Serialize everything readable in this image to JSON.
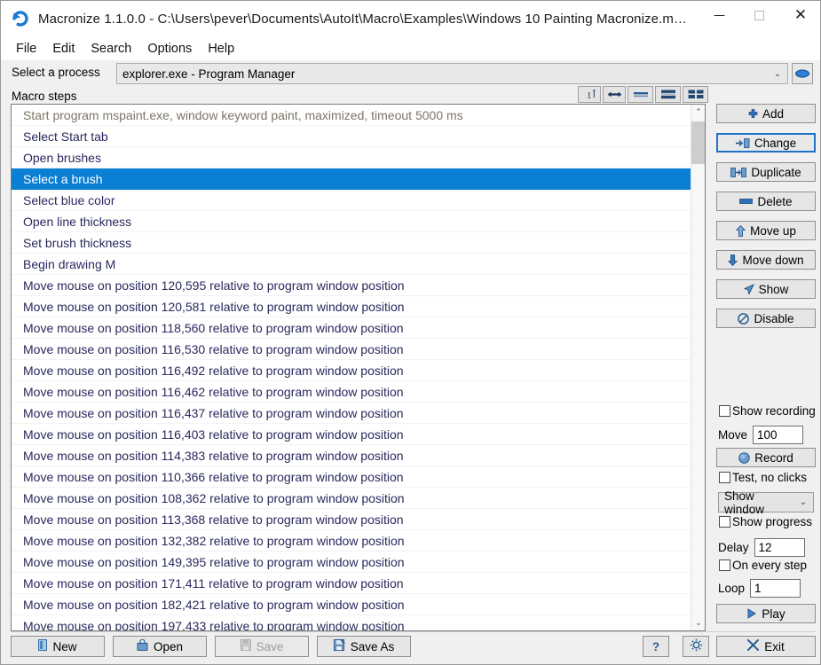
{
  "window": {
    "title": "Macronize 1.1.0.0 - C:\\Users\\pever\\Documents\\AutoIt\\Macro\\Examples\\Windows 10 Painting Macronize.m…",
    "app_icon": "refresh-circle-icon",
    "minimize": "—",
    "maximize": "▢",
    "close": "✕"
  },
  "menu": {
    "items": [
      {
        "label": "File"
      },
      {
        "label": "Edit"
      },
      {
        "label": "Search"
      },
      {
        "label": "Options"
      },
      {
        "label": "Help"
      }
    ]
  },
  "process": {
    "label": "Select a process",
    "value": "explorer.exe - Program Manager",
    "arrow": "⌄",
    "eye_icon": "eye-icon"
  },
  "steps": {
    "label": "Macro steps",
    "tools": [
      {
        "name": "numbering-icon",
        "title": "1"
      },
      {
        "name": "resize-horizontal-icon",
        "title": "↔"
      },
      {
        "name": "view-single-line-icon",
        "title": "="
      },
      {
        "name": "view-two-line-icon",
        "title": "≡"
      },
      {
        "name": "view-grid-icon",
        "title": "▦"
      }
    ],
    "rows": [
      {
        "text": "Start program mspaint.exe, window keyword paint, maximized, timeout 5000 ms",
        "state": "dim"
      },
      {
        "text": "Select Start tab",
        "state": "normal"
      },
      {
        "text": "Open brushes",
        "state": "normal"
      },
      {
        "text": "Select a brush",
        "state": "selected"
      },
      {
        "text": "Select blue color",
        "state": "normal"
      },
      {
        "text": "Open line thickness",
        "state": "normal"
      },
      {
        "text": "Set brush thickness",
        "state": "normal"
      },
      {
        "text": "Begin drawing M",
        "state": "normal"
      },
      {
        "text": "Move mouse on position 120,595 relative to program window position",
        "state": "normal"
      },
      {
        "text": "Move mouse on position 120,581 relative to program window position",
        "state": "normal"
      },
      {
        "text": "Move mouse on position 118,560 relative to program window position",
        "state": "normal"
      },
      {
        "text": "Move mouse on position 116,530 relative to program window position",
        "state": "normal"
      },
      {
        "text": "Move mouse on position 116,492 relative to program window position",
        "state": "normal"
      },
      {
        "text": "Move mouse on position 116,462 relative to program window position",
        "state": "normal"
      },
      {
        "text": "Move mouse on position 116,437 relative to program window position",
        "state": "normal"
      },
      {
        "text": "Move mouse on position 116,403 relative to program window position",
        "state": "normal"
      },
      {
        "text": "Move mouse on position 114,383 relative to program window position",
        "state": "normal"
      },
      {
        "text": "Move mouse on position 110,366 relative to program window position",
        "state": "normal"
      },
      {
        "text": "Move mouse on position 108,362 relative to program window position",
        "state": "normal"
      },
      {
        "text": "Move mouse on position 113,368 relative to program window position",
        "state": "normal"
      },
      {
        "text": "Move mouse on position 132,382 relative to program window position",
        "state": "normal"
      },
      {
        "text": "Move mouse on position 149,395 relative to program window position",
        "state": "normal"
      },
      {
        "text": "Move mouse on position 171,411 relative to program window position",
        "state": "normal"
      },
      {
        "text": "Move mouse on position 182,421 relative to program window position",
        "state": "normal"
      },
      {
        "text": "Move mouse on position 197,433 relative to program window position",
        "state": "normal"
      }
    ],
    "scroll_up_arrow": "⌃",
    "scroll_down_arrow": "⌄"
  },
  "actions": {
    "add": "Add",
    "change": "Change",
    "duplicate": "Duplicate",
    "delete": "Delete",
    "move_up": "Move up",
    "move_down": "Move down",
    "show": "Show",
    "disable": "Disable"
  },
  "options": {
    "show_recording": "Show recording",
    "move_label": "Move",
    "move_value": "100",
    "record": "Record",
    "test_no_clicks": "Test, no clicks",
    "show_window": "Show window",
    "show_window_arrow": "⌄",
    "show_progress": "Show progress",
    "delay_label": "Delay",
    "delay_value": "12",
    "on_every_step": "On every step",
    "loop_label": "Loop",
    "loop_value": "1",
    "play": "Play"
  },
  "bottom": {
    "new": "New",
    "open": "Open",
    "save": "Save",
    "save_as": "Save As",
    "help": "?",
    "settings": "gear-icon",
    "exit": "Exit"
  },
  "colors": {
    "accent": "#0a7fd4",
    "list_text": "#29295e",
    "dim_text": "#7c7566",
    "focus_border": "#1f72c8",
    "icon_blue": "#1f5b9e"
  }
}
